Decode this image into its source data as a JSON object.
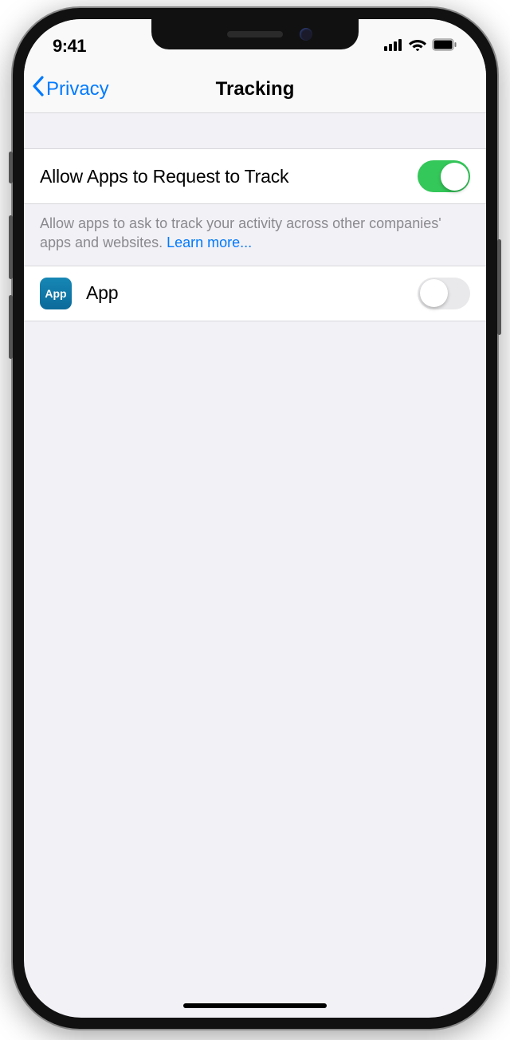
{
  "status": {
    "time": "9:41"
  },
  "nav": {
    "back_label": "Privacy",
    "title": "Tracking"
  },
  "main_toggle": {
    "label": "Allow Apps to Request to Track",
    "on": true
  },
  "description": {
    "text": "Allow apps to ask to track your activity across other companies' apps and websites. ",
    "learn_more": "Learn more..."
  },
  "apps": [
    {
      "icon_text": "App",
      "name": "App",
      "on": false
    }
  ]
}
